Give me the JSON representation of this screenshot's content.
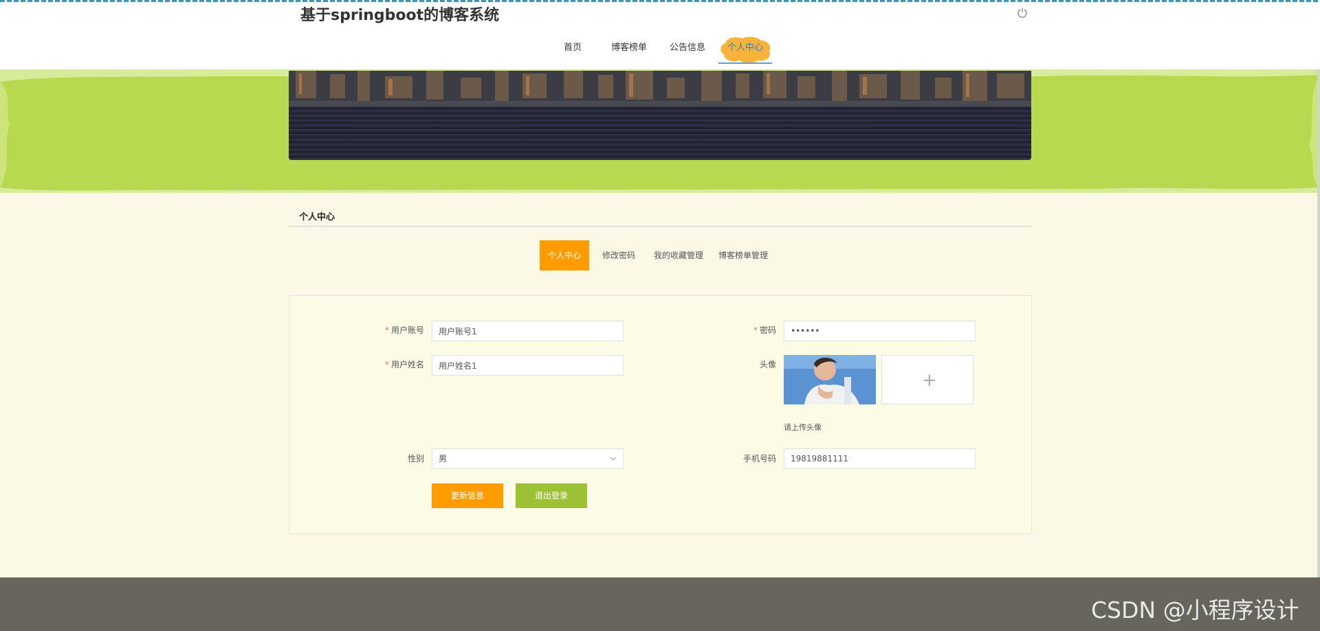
{
  "app": {
    "title": "基于springboot的博客系统"
  },
  "nav": {
    "items": [
      "首页",
      "博客榜单",
      "公告信息"
    ],
    "active": "个人中心"
  },
  "section": {
    "title": "个人中心"
  },
  "tabs": {
    "active": "个人中心",
    "items": [
      "修改密码",
      "我的收藏管理",
      "博客榜单管理"
    ]
  },
  "form": {
    "username_label": "用户账号",
    "username_value": "用户账号1",
    "password_label": "密码",
    "password_value": "••••••",
    "realname_label": "用户姓名",
    "realname_value": "用户姓名1",
    "avatar_label": "头像",
    "avatar_hint": "请上传头像",
    "gender_label": "性别",
    "gender_value": "男",
    "phone_label": "手机号码",
    "phone_value": "19819881111",
    "required_mark": "*"
  },
  "buttons": {
    "update": "更新信息",
    "logout": "退出登录"
  },
  "watermark": "CSDN @小程序设计",
  "colors": {
    "accent": "#ff9d00",
    "green": "#9dc134",
    "band": "#b7d94f",
    "footer": "#67655c"
  }
}
